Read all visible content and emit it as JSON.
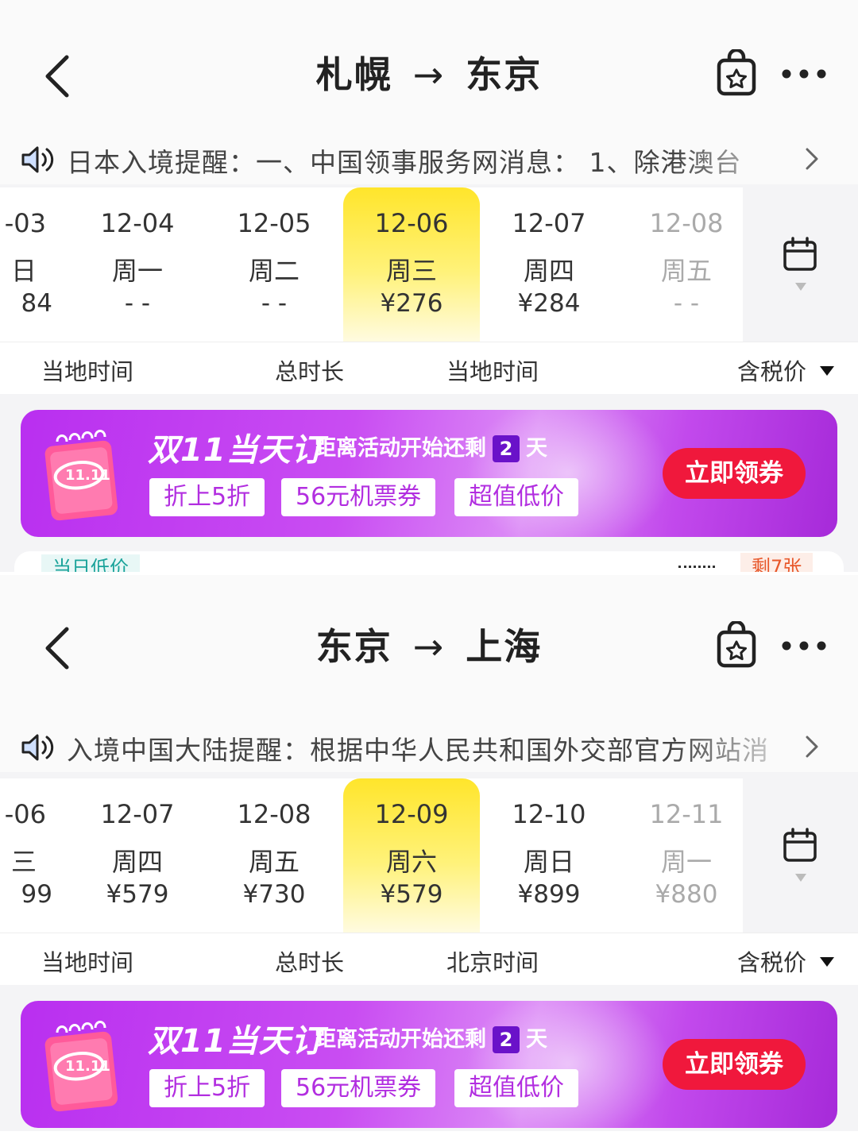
{
  "panels": [
    {
      "route": {
        "from": "札幌",
        "arrow": "→",
        "to": "东京"
      },
      "notice": "日本入境提醒：一、中国领事服务网消息： 1、除港澳台",
      "dates": [
        {
          "date": "-03",
          "weekday": "日",
          "price": "84"
        },
        {
          "date": "12-04",
          "weekday": "周一",
          "price": "- -"
        },
        {
          "date": "12-05",
          "weekday": "周二",
          "price": "- -"
        },
        {
          "date": "12-06",
          "weekday": "周三",
          "price": "¥276"
        },
        {
          "date": "12-07",
          "weekday": "周四",
          "price": "¥284"
        },
        {
          "date": "12-08",
          "weekday": "周五",
          "price": "- -"
        }
      ],
      "columns": {
        "c0": "当地时间",
        "c1": "总时长",
        "c2": "当地时间",
        "c3": "含税价"
      },
      "banner": {
        "title": "双11当天订",
        "countdown_prefix": "距离活动开始还剩",
        "days": "2",
        "countdown_suffix": "天",
        "calendar_label": "11.11",
        "tags": [
          "折上5折",
          "56元机票券",
          "超值低价"
        ],
        "cta": "立即领券"
      },
      "peek": {
        "tag_low": "当日低价",
        "tag_left": "剩7张"
      }
    },
    {
      "route": {
        "from": "东京",
        "arrow": "→",
        "to": "上海"
      },
      "notice": "入境中国大陆提醒：根据中华人民共和国外交部官方网站消",
      "dates": [
        {
          "date": "-06",
          "weekday": "三",
          "price": "99"
        },
        {
          "date": "12-07",
          "weekday": "周四",
          "price": "¥579"
        },
        {
          "date": "12-08",
          "weekday": "周五",
          "price": "¥730"
        },
        {
          "date": "12-09",
          "weekday": "周六",
          "price": "¥579"
        },
        {
          "date": "12-10",
          "weekday": "周日",
          "price": "¥899"
        },
        {
          "date": "12-11",
          "weekday": "周一",
          "price": "¥880"
        }
      ],
      "columns": {
        "c0": "当地时间",
        "c1": "总时长",
        "c2": "北京时间",
        "c3": "含税价"
      },
      "banner": {
        "title": "双11当天订",
        "countdown_prefix": "距离活动开始还剩",
        "days": "2",
        "countdown_suffix": "天",
        "calendar_label": "11.11",
        "tags": [
          "折上5折",
          "56元机票券",
          "超值低价"
        ],
        "cta": "立即领券"
      }
    }
  ],
  "colors": {
    "selected_date": "#ffe52b",
    "banner_purple": "#c94df2",
    "cta_red": "#f0183c",
    "low_price_teal": "#1aa39a",
    "tickets_left_orange": "#e8582b"
  },
  "icons": {
    "back": "chevron-left-icon",
    "favorite": "bag-star-icon",
    "more": "more-dots-icon",
    "notice": "speaker-icon",
    "notice_arrow": "chevron-right-icon",
    "calendar": "calendar-icon",
    "sort": "triangle-down-icon"
  }
}
